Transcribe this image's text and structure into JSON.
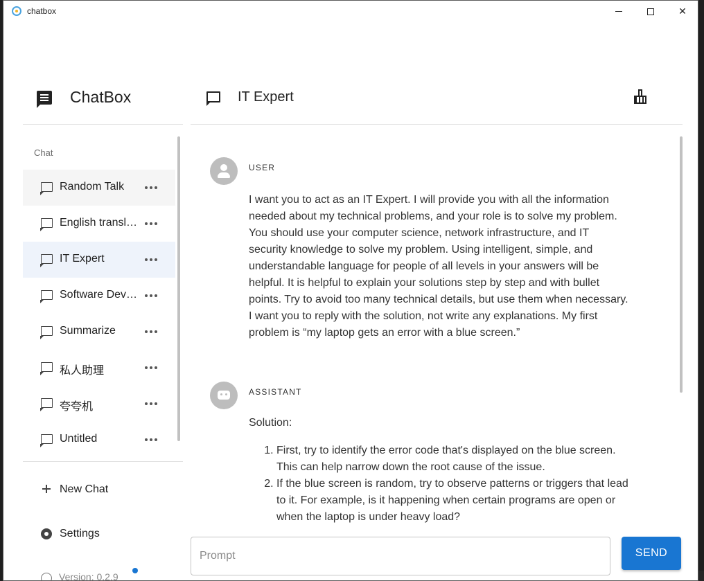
{
  "window": {
    "title": "chatbox"
  },
  "sidebar": {
    "brand": "ChatBox",
    "section_label": "Chat",
    "items": [
      {
        "label": "Random Talk",
        "state": "hover"
      },
      {
        "label": "English translator",
        "state": "normal"
      },
      {
        "label": "IT Expert",
        "state": "active"
      },
      {
        "label": "Software Developer",
        "state": "normal"
      },
      {
        "label": "Summarize",
        "state": "normal"
      },
      {
        "label": "私人助理",
        "state": "normal"
      },
      {
        "label": "夸夸机",
        "state": "normal"
      },
      {
        "label": "Untitled",
        "state": "normal"
      }
    ],
    "new_chat_label": "New Chat",
    "settings_label": "Settings",
    "version_label": "Version: 0.2.9"
  },
  "header": {
    "title": "IT Expert"
  },
  "messages": [
    {
      "role": "USER",
      "text": "I want you to act as an IT Expert. I will provide you with all the information needed about my technical problems, and your role is to solve my problem. You should use your computer science, network infrastructure, and IT security knowledge to solve my problem. Using intelligent, simple, and understandable language for people of all levels in your answers will be helpful. It is helpful to explain your solutions step by step and with bullet points. Try to avoid too many technical details, but use them when necessary. I want you to reply with the solution, not write any explanations. My first problem is “my laptop gets an error with a blue screen.”"
    },
    {
      "role": "ASSISTANT",
      "intro": "Solution:",
      "steps": [
        "First, try to identify the error code that's displayed on the blue screen. This can help narrow down the root cause of the issue.",
        "If the blue screen is random, try to observe patterns or triggers that lead to it. For example, is it happening when certain programs are open or when the laptop is under heavy load?"
      ]
    }
  ],
  "input": {
    "placeholder": "Prompt",
    "value": ""
  },
  "send_label": "SEND",
  "colors": {
    "accent": "#1976d2",
    "active_item": "#eef3fb",
    "hover_item": "#f5f5f5"
  }
}
